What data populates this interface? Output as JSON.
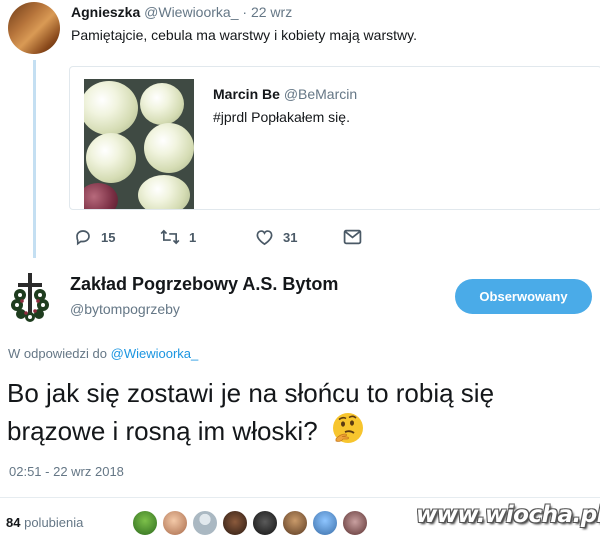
{
  "parent_tweet": {
    "author_name": "Agnieszka",
    "author_handle": "@Wiewioorka_",
    "separator": "·",
    "time": "22 wrz",
    "text": "Pamiętajcie, cebula ma warstwy i kobiety mają warstwy.",
    "quoted": {
      "author_name": "Marcin Be",
      "author_handle": "@BeMarcin",
      "text": "#jprdl Popłakałem się."
    },
    "actions": {
      "reply_count": "15",
      "retweet_count": "1",
      "like_count": "31"
    }
  },
  "main_tweet": {
    "author_name": "Zakład Pogrzebowy A.S. Bytom",
    "author_handle": "@bytompogrzeby",
    "follow_button_label": "Obserwowany",
    "reply_prefix": "W odpowiedzi do",
    "reply_to_handle": "@Wiewioorka_",
    "text": "Bo jak się zostawi je na słońcu to robią się brązowe i rosną im włoski?",
    "timestamp": "02:51 - 22 wrz 2018",
    "likes_count": "84",
    "likes_label": "polubienia"
  },
  "icons": {
    "reply": "reply-icon",
    "retweet": "retweet-icon",
    "like": "heart-icon",
    "dm": "envelope-icon",
    "emoji": "thinking-face-emoji"
  },
  "colors": {
    "accent": "#1b95e0",
    "follow_button": "#4aabe8",
    "thread_line": "#c4dff2",
    "secondary_text": "#657786"
  },
  "watermark": "www.wiocha.pl"
}
